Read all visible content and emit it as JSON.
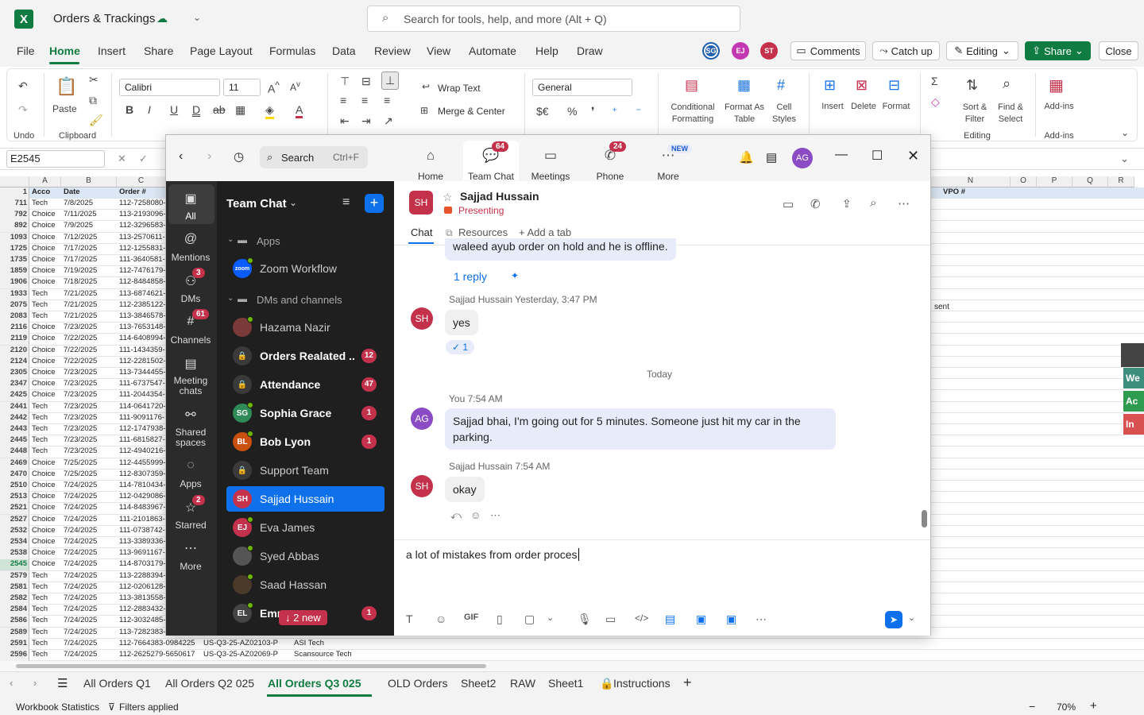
{
  "excel": {
    "doc_name": "Orders & Trackings",
    "search_placeholder": "Search for tools, help, and more (Alt + Q)",
    "menu": [
      "File",
      "Home",
      "Insert",
      "Share",
      "Page Layout",
      "Formulas",
      "Data",
      "Review",
      "View",
      "Automate",
      "Help",
      "Draw"
    ],
    "avatars": [
      {
        "text": "SG",
        "color": "#1f5fb0"
      },
      {
        "text": "EJ",
        "color": "#c239b3"
      },
      {
        "text": "ST",
        "color": "#c4314b"
      }
    ],
    "comments": "Comments",
    "catchup": "Catch up",
    "editing": "Editing",
    "share": "Share",
    "close": "Close",
    "ribbon": {
      "undo": "Undo",
      "paste": "Paste",
      "clipboard": "Clipboard",
      "font": "Calibri",
      "size": "11",
      "wrap": "Wrap Text",
      "merge": "Merge & Center",
      "number_format": "General",
      "cond1": "Conditional",
      "cond2": "Formatting",
      "fmt1": "Format As",
      "fmt2": "Table",
      "cs1": "Cell",
      "cs2": "Styles",
      "insert": "Insert",
      "delete": "Delete",
      "format": "Format",
      "sort1": "Sort &",
      "sort2": "Filter",
      "find1": "Find &",
      "find2": "Select",
      "editing": "Editing",
      "addins": "Add-ins",
      "addins_group": "Add-ins"
    },
    "namebox": "E2545",
    "col_headers": [
      "A",
      "B",
      "C",
      "N",
      "O",
      "P",
      "Q",
      "R"
    ],
    "header_row": {
      "rn": "1",
      "a": "Acco",
      "b": "Date",
      "c": "Order #",
      "n": "VPO #"
    },
    "rows": [
      [
        "711",
        "Tech",
        "7/8/2025",
        "112-7258080-"
      ],
      [
        "792",
        "Choice",
        "7/11/2025",
        "113-2193096-"
      ],
      [
        "892",
        "Choice",
        "7/9/2025",
        "112-3296583-"
      ],
      [
        "1093",
        "Choice",
        "7/12/2025",
        "113-2570611-"
      ],
      [
        "1725",
        "Choice",
        "7/17/2025",
        "112-1255831-"
      ],
      [
        "1735",
        "Choice",
        "7/17/2025",
        "111-3640581-"
      ],
      [
        "1859",
        "Choice",
        "7/19/2025",
        "112-7476179-"
      ],
      [
        "1906",
        "Choice",
        "7/18/2025",
        "112-8484858-"
      ],
      [
        "1933",
        "Tech",
        "7/21/2025",
        "113-6874621-"
      ],
      [
        "2075",
        "Tech",
        "7/21/2025",
        "112-2385122-"
      ],
      [
        "2083",
        "Tech",
        "7/21/2025",
        "113-3846578-"
      ],
      [
        "2116",
        "Choice",
        "7/23/2025",
        "113-7653148-"
      ],
      [
        "2119",
        "Choice",
        "7/22/2025",
        "114-6408994-"
      ],
      [
        "2120",
        "Choice",
        "7/22/2025",
        "111-1434359-"
      ],
      [
        "2124",
        "Choice",
        "7/22/2025",
        "112-2281502-"
      ],
      [
        "2305",
        "Choice",
        "7/23/2025",
        "113-7344455-"
      ],
      [
        "2347",
        "Choice",
        "7/23/2025",
        "111-6737547-"
      ],
      [
        "2425",
        "Choice",
        "7/23/2025",
        "111-2044354-"
      ],
      [
        "2441",
        "Tech",
        "7/23/2025",
        "114-0641720-"
      ],
      [
        "2442",
        "Tech",
        "7/23/2025",
        "111-9091176-"
      ],
      [
        "2443",
        "Tech",
        "7/23/2025",
        "112-1747938-"
      ],
      [
        "2445",
        "Tech",
        "7/23/2025",
        "111-6815827-"
      ],
      [
        "2448",
        "Tech",
        "7/23/2025",
        "112-4940216-"
      ],
      [
        "2469",
        "Choice",
        "7/25/2025",
        "112-4455999-"
      ],
      [
        "2470",
        "Choice",
        "7/25/2025",
        "112-8307359-"
      ],
      [
        "2510",
        "Choice",
        "7/24/2025",
        "114-7810434-"
      ],
      [
        "2513",
        "Choice",
        "7/24/2025",
        "112-0429086-"
      ],
      [
        "2521",
        "Choice",
        "7/24/2025",
        "114-8483967-"
      ],
      [
        "2527",
        "Choice",
        "7/24/2025",
        "111-2101863-"
      ],
      [
        "2532",
        "Choice",
        "7/24/2025",
        "111-0738742-"
      ],
      [
        "2534",
        "Choice",
        "7/24/2025",
        "113-3389336-"
      ],
      [
        "2538",
        "Choice",
        "7/24/2025",
        "113-9691167-"
      ],
      [
        "2545",
        "Choice",
        "7/24/2025",
        "114-8703179-"
      ],
      [
        "2579",
        "Tech",
        "7/24/2025",
        "113-2288394-"
      ],
      [
        "2581",
        "Tech",
        "7/24/2025",
        "112-0206128-"
      ],
      [
        "2582",
        "Tech",
        "7/24/2025",
        "113-3813558-"
      ],
      [
        "2584",
        "Tech",
        "7/24/2025",
        "112-2883432-"
      ],
      [
        "2586",
        "Tech",
        "7/24/2025",
        "112-3032485-"
      ],
      [
        "2589",
        "Tech",
        "7/24/2025",
        "113-7282383-"
      ]
    ],
    "extra_rows": [
      {
        "rn": "2591",
        "a": "Tech",
        "b": "7/24/2025",
        "c": "112-7664383-0984225",
        "d": "US-Q3-25-AZ02103-P",
        "e": "ASI Tech"
      },
      {
        "rn": "2596",
        "a": "Tech",
        "b": "7/24/2025",
        "c": "112-2625279-5650617",
        "d": "US-Q3-25-AZ02069-P",
        "e": "Scansource Tech"
      }
    ],
    "sent_text": "sent",
    "side_tags": [
      "We",
      "Ac",
      "In"
    ],
    "sheets": [
      "All Orders Q1",
      "All Orders Q2 025",
      "All Orders Q3 025",
      "OLD Orders",
      "Sheet2",
      "RAW",
      "Sheet1",
      "Instructions"
    ],
    "status_left": "Workbook Statistics",
    "status_filters": "Filters applied",
    "zoom": "70%"
  },
  "teams": {
    "search": "Search",
    "search_shortcut": "Ctrl+F",
    "nav": [
      {
        "label": "Home",
        "badge": ""
      },
      {
        "label": "Team Chat",
        "badge": "64"
      },
      {
        "label": "Meetings",
        "badge": ""
      },
      {
        "label": "Phone",
        "badge": "24"
      },
      {
        "label": "More",
        "badge": "NEW"
      }
    ],
    "avatar": "AG",
    "rail": [
      {
        "label": "All",
        "badge": ""
      },
      {
        "label": "Mentions",
        "badge": ""
      },
      {
        "label": "DMs",
        "badge": "3"
      },
      {
        "label": "Channels",
        "badge": "61"
      },
      {
        "label": "Meeting chats",
        "badge": ""
      },
      {
        "label": "Shared spaces",
        "badge": ""
      },
      {
        "label": "Apps",
        "badge": ""
      },
      {
        "label": "Starred",
        "badge": "2"
      },
      {
        "label": "More",
        "badge": ""
      }
    ],
    "list_title": "Team Chat",
    "section_apps": "Apps",
    "section_dms": "DMs and channels",
    "items": [
      {
        "name": "Zoom Workflow",
        "av": "zoom",
        "color": "#0b5cff",
        "badge": "",
        "bold": false
      },
      {
        "name": "Hazama Nazir",
        "av": "",
        "color": "#7a3a3a",
        "badge": "",
        "bold": false
      },
      {
        "name": "Orders Realated ...",
        "av": "🔒",
        "color": "#3a3a3a",
        "badge": "12",
        "bold": true
      },
      {
        "name": "Attendance",
        "av": "🔒",
        "color": "#3a3a3a",
        "badge": "47",
        "bold": true
      },
      {
        "name": "Sophia Grace",
        "av": "SG",
        "color": "#2e8b57",
        "badge": "1",
        "bold": true
      },
      {
        "name": "Bob Lyon",
        "av": "BL",
        "color": "#ca5010",
        "badge": "1",
        "bold": true
      },
      {
        "name": "Support Team",
        "av": "🔒",
        "color": "#3a3a3a",
        "badge": "",
        "bold": false
      },
      {
        "name": "Sajjad Hussain",
        "av": "SH",
        "color": "#c4314b",
        "badge": "",
        "bold": false
      },
      {
        "name": "Eva James",
        "av": "EJ",
        "color": "#c4314b",
        "badge": "",
        "bold": false
      },
      {
        "name": "Syed Abbas",
        "av": "",
        "color": "#555",
        "badge": "",
        "bold": false
      },
      {
        "name": "Saad Hassan",
        "av": "",
        "color": "#4a3a2a",
        "badge": "",
        "bold": false
      },
      {
        "name": "Emm",
        "av": "EL",
        "color": "#444",
        "badge": "1",
        "bold": true
      }
    ],
    "new_pill": "↓ 2 new",
    "chat_name": "Sajjad Hussain",
    "chat_av": "SH",
    "presence": "Presenting",
    "tabs": [
      "Chat",
      "Resources",
      "+ Add a tab"
    ],
    "prev_msg": "waleed ayub order on hold and he is offline.",
    "reply_link": "1 reply",
    "m1_meta": "Sajjad Hussain",
    "m1_time": "Yesterday, 3:47 PM",
    "m1_text": "yes",
    "m1_react": "✓ 1",
    "divider": "Today",
    "m2_meta": "You 7:54 AM",
    "m2_text": "Sajjad bhai, I'm going out for 5 minutes. Someone just hit my car in the parking.",
    "m3_meta": "Sajjad Hussain",
    "m3_time": "7:54 AM",
    "m3_text": "okay",
    "compose": "a lot of mistakes from order proces"
  }
}
